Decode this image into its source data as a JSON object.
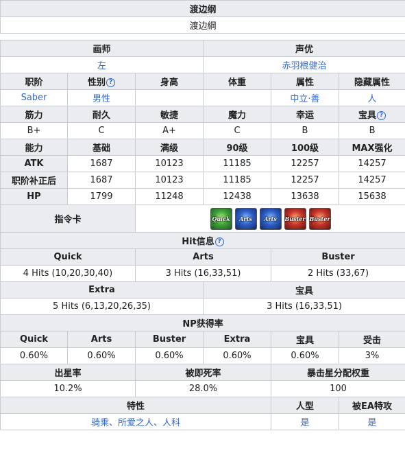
{
  "header": {
    "title": "渡边纲",
    "subtitle": "渡边綱"
  },
  "staff": {
    "illustrator_label": "画师",
    "voice_label": "声优",
    "illustrator": "左",
    "voice": "赤羽根健治"
  },
  "profile": {
    "labels": [
      "职阶",
      "性别",
      "身高",
      "体重",
      "属性",
      "隐藏属性"
    ],
    "values": [
      "Saber",
      "男性",
      "",
      "",
      "中立·善",
      "人"
    ]
  },
  "params": {
    "labels": [
      "筋力",
      "耐久",
      "敏捷",
      "魔力",
      "幸运",
      "宝具"
    ],
    "values": [
      "B+",
      "C",
      "A+",
      "C",
      "B",
      "B"
    ]
  },
  "stats": {
    "headers": [
      "能力",
      "基础",
      "满级",
      "90级",
      "100级",
      "MAX强化"
    ],
    "rows": [
      {
        "label": "ATK",
        "values": [
          "1687",
          "10123",
          "11185",
          "12257",
          "14257"
        ]
      },
      {
        "label": "职阶补正后",
        "values": [
          "1687",
          "10123",
          "11185",
          "12257",
          "14257"
        ]
      },
      {
        "label": "HP",
        "values": [
          "1799",
          "11248",
          "12438",
          "13638",
          "15638"
        ]
      }
    ]
  },
  "command_cards": {
    "label": "指令卡",
    "cards": [
      {
        "type": "quick",
        "text": "Quick",
        "icon": "quick-card-icon"
      },
      {
        "type": "arts",
        "text": "Arts",
        "icon": "arts-card-icon"
      },
      {
        "type": "arts",
        "text": "Arts",
        "icon": "arts-card-icon"
      },
      {
        "type": "buster",
        "text": "Buster",
        "icon": "buster-card-icon"
      },
      {
        "type": "buster",
        "text": "Buster",
        "icon": "buster-card-icon"
      }
    ]
  },
  "hits": {
    "title": "Hit信息",
    "quick_label": "Quick",
    "arts_label": "Arts",
    "buster_label": "Buster",
    "quick": "4 Hits (10,20,30,40)",
    "arts": "3 Hits (16,33,51)",
    "buster": "2 Hits (33,67)",
    "extra_label": "Extra",
    "np_label": "宝具",
    "extra": "5 Hits (6,13,20,26,35)",
    "np": "3 Hits (16,33,51)"
  },
  "np_gain": {
    "title": "NP获得率",
    "labels": [
      "Quick",
      "Arts",
      "Buster",
      "Extra",
      "宝具",
      "受击"
    ],
    "values": [
      "0.60%",
      "0.60%",
      "0.60%",
      "0.60%",
      "0.60%",
      "3%"
    ]
  },
  "stars": {
    "labels": [
      "出星率",
      "被即死率",
      "暴击星分配权重"
    ],
    "values": [
      "10.2%",
      "28.0%",
      "100"
    ]
  },
  "traits": {
    "label": "特性",
    "humanoid_label": "人型",
    "ea_label": "被EA特攻",
    "value": "骑乘、所爱之人、人科",
    "humanoid": "是",
    "ea": "是"
  },
  "colors": {
    "header_bg": "#eaecf0",
    "border": "#c8ccd1",
    "link": "#3366cc"
  }
}
